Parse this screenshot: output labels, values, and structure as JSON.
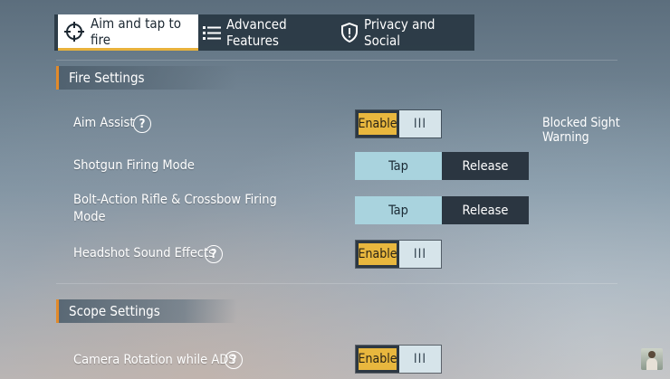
{
  "tabs": [
    {
      "label": "Aim and tap to fire",
      "icon": "crosshair-icon",
      "active": true
    },
    {
      "label": "Advanced Features",
      "icon": "list-icon",
      "active": false
    },
    {
      "label": "Privacy and Social",
      "icon": "shield-icon",
      "active": false
    }
  ],
  "sections": {
    "fire": {
      "title": "Fire Settings",
      "rows": [
        {
          "label": "Aim Assist",
          "toggle": "Enable",
          "knob": "III",
          "help": "?"
        },
        {
          "label": "Shotgun Firing Mode",
          "option_a": "Tap",
          "option_b": "Release",
          "selected": "Tap"
        },
        {
          "label_line1": "Bolt-Action Rifle & Crossbow Firing",
          "label_line2": "Mode",
          "option_a": "Tap",
          "option_b": "Release",
          "selected": "Tap"
        },
        {
          "label": "Headshot Sound Effects",
          "toggle": "Enable",
          "knob": "III",
          "help": "?"
        }
      ],
      "side_label": "Blocked Sight Warning"
    },
    "scope": {
      "title": "Scope Settings",
      "rows": [
        {
          "label": "Camera Rotation while ADS",
          "toggle": "Enable",
          "knob": "III",
          "help": "?"
        }
      ]
    }
  },
  "colors": {
    "accent": "#e8b73e",
    "section_marker": "#e28a2a",
    "tab_bar": "#263440",
    "option_selected": "#a9d3de",
    "option_unselected": "#2b3641"
  }
}
